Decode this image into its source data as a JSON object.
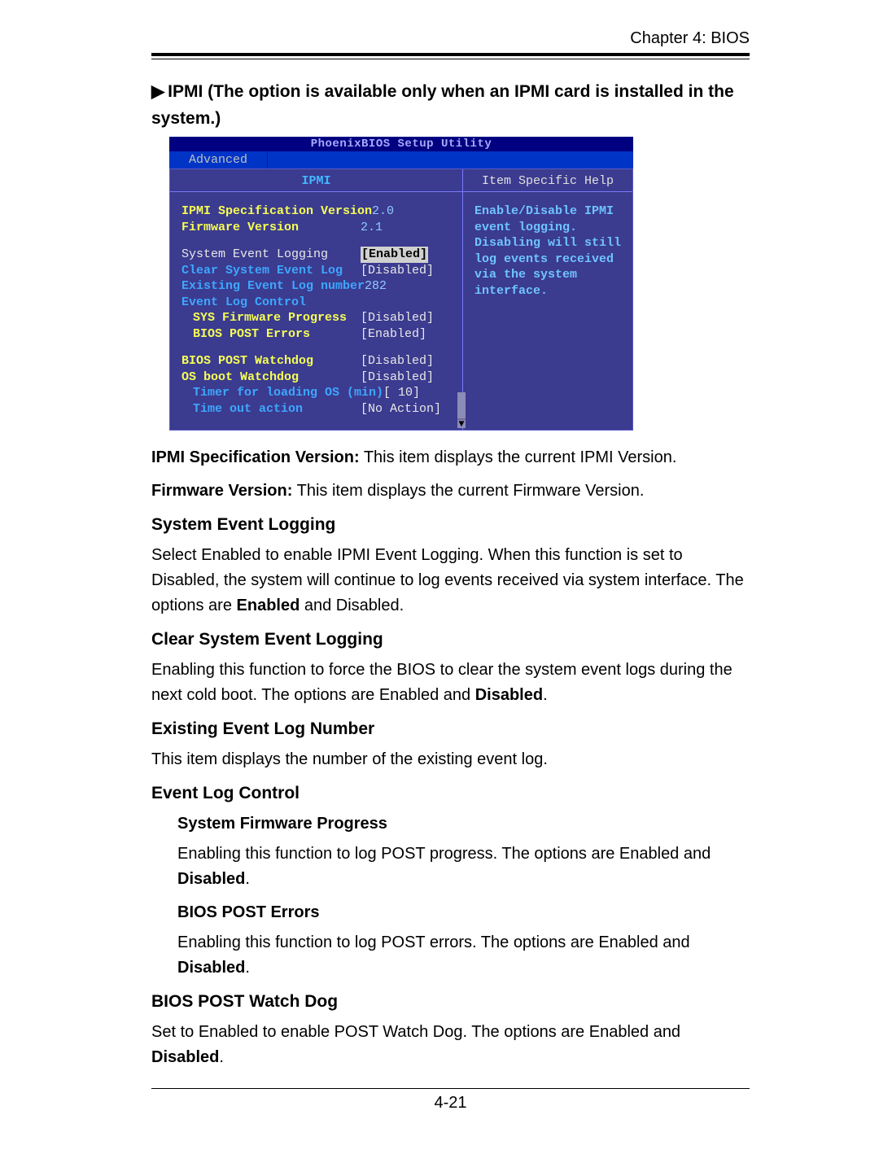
{
  "header": {
    "chapter": "Chapter 4: BIOS"
  },
  "section_title_line1_prefix": "▶",
  "section_title_text": "IPMI (The option is available only when an IPMI card is installed in the system.)",
  "bios": {
    "utility_title": "PhoenixBIOS Setup Utility",
    "tab_label": "Advanced",
    "left_title": "IPMI",
    "right_title": "Item Specific Help",
    "rows": {
      "ipmi_spec_label": "IPMI Specification Version",
      "ipmi_spec_value": "2.0",
      "fw_ver_label": "Firmware Version",
      "fw_ver_value": "2.1",
      "sys_evt_log_label": "System Event Logging",
      "sys_evt_log_value": "[Enabled]",
      "clear_evt_label": "Clear System Event Log",
      "clear_evt_value": "[Disabled]",
      "exist_evt_label": "Existing Event Log number",
      "exist_evt_value": "282",
      "evt_ctrl_label": "Event Log Control",
      "sys_fw_prog_label": "SYS Firmware Progress",
      "sys_fw_prog_value": "[Disabled]",
      "bios_post_err_label": "BIOS POST Errors",
      "bios_post_err_value": "[Enabled]",
      "bios_post_wd_label": "BIOS POST Watchdog",
      "bios_post_wd_value": "[Disabled]",
      "os_boot_wd_label": "OS boot Watchdog",
      "os_boot_wd_value": "[Disabled]",
      "timer_load_label": "Timer for loading OS (min)",
      "timer_load_value": "[ 10]",
      "timeout_label": "Time out action",
      "timeout_value": "[No Action]"
    },
    "help_text": "Enable/Disable IPMI event logging. Disabling will still log events received via the system interface."
  },
  "doc": {
    "p1_lead": "IPMI Specification Version:",
    "p1_rest": " This item displays the current IPMI Version.",
    "p2_lead": "Firmware Version:",
    "p2_rest": " This item displays the current Firmware Version.",
    "h3_1": "System Event Logging",
    "p3_a": "Select Enabled to enable IPMI Event Logging. When this function is set to Disabled, the system will continue to log events received via system interface. The options are ",
    "p3_b_bold": "Enabled",
    "p3_c": " and Disabled.",
    "h3_2": "Clear System Event Logging",
    "p4_a": "Enabling this function to force the BIOS to clear the system event logs during the next cold boot. The options are Enabled and ",
    "p4_b_bold": "Disabled",
    "p4_c": ".",
    "h3_3": "Existing Event Log Number",
    "p5": "This item displays the number of the existing event log.",
    "h3_4": "Event Log Control",
    "h4_1": "System Firmware Progress",
    "p6_a": "Enabling this function to log POST progress. The options are Enabled and ",
    "p6_b_bold": "Disabled",
    "p6_c": ".",
    "h4_2": "BIOS POST Errors",
    "p7_a": "Enabling this function to log POST errors. The options are Enabled and ",
    "p7_b_bold": "Disabled",
    "p7_c": ".",
    "h3_5": "BIOS POST Watch Dog",
    "p8_a": "Set to Enabled to enable POST Watch Dog. The options are Enabled and ",
    "p8_b_bold": "Disabled",
    "p8_c": "."
  },
  "page_number": "4-21"
}
